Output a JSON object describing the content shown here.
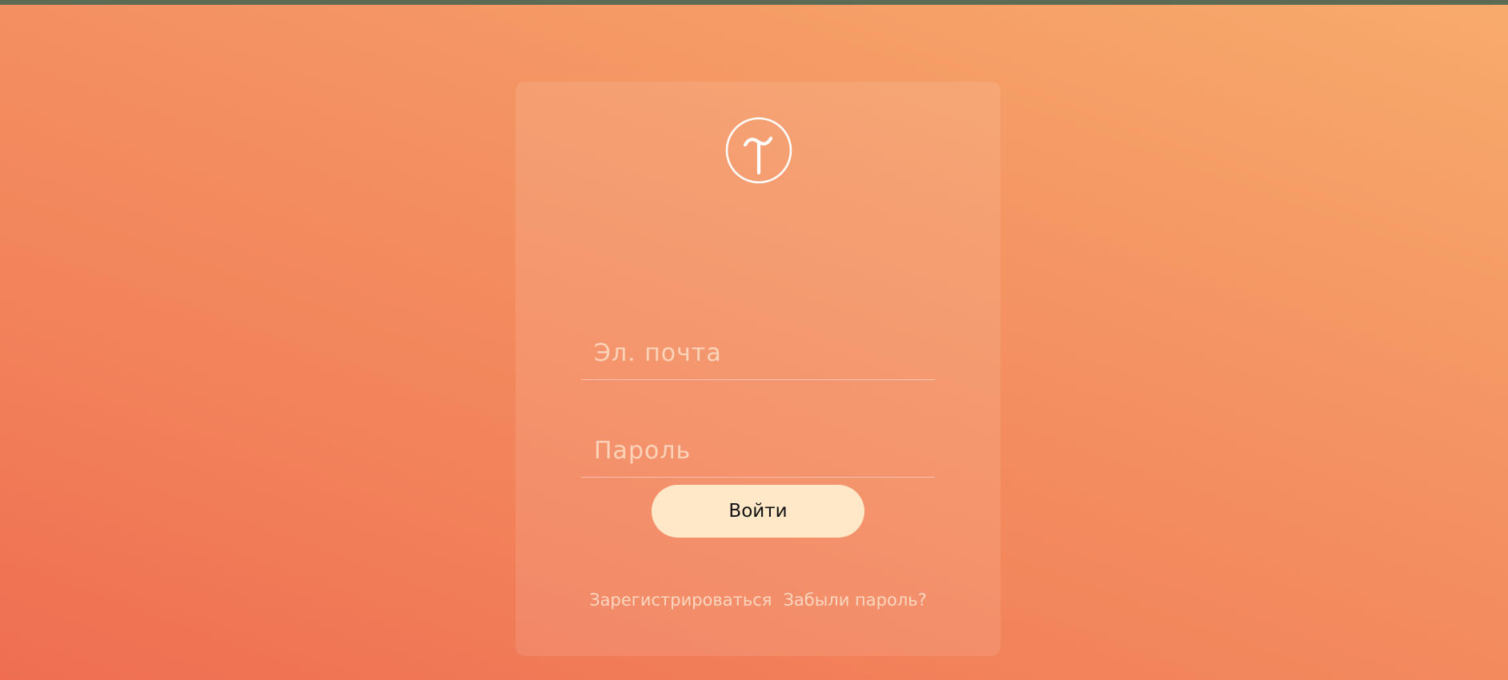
{
  "colors": {
    "top_strip": "#5d6b55",
    "background_light": "#f8ab6c",
    "background_dark": "#ef6e52",
    "button_fill": "#ffe8c8",
    "button_text": "#111111"
  },
  "logo": {
    "icon": "tilda-logo-icon"
  },
  "form": {
    "email": {
      "placeholder": "Эл. почта",
      "value": ""
    },
    "password": {
      "placeholder": "Пароль",
      "value": ""
    },
    "submit_label": "Войти"
  },
  "links": {
    "register": "Зарегистрироваться",
    "forgot_password": "Забыли пароль?"
  }
}
